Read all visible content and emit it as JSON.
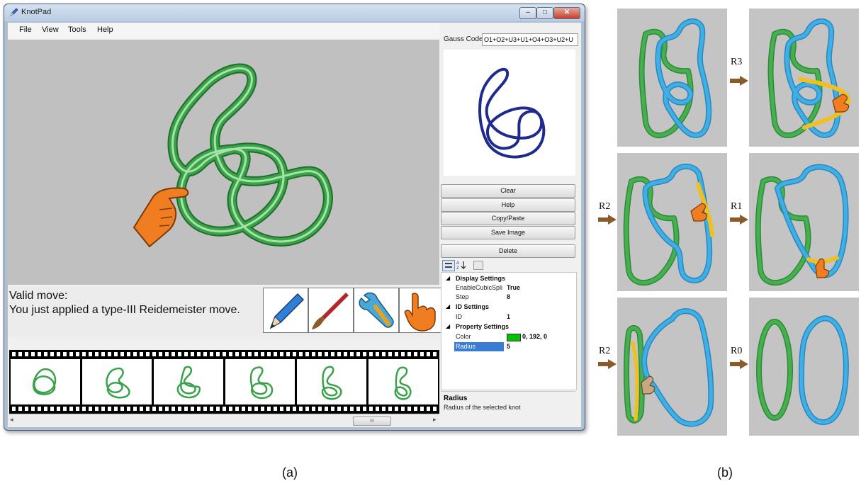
{
  "window": {
    "title": "KnotPad",
    "controls": [
      "–",
      "□",
      "✕"
    ]
  },
  "menu": [
    "File",
    "View",
    "Tools",
    "Help"
  ],
  "status": {
    "line1": "Valid move:",
    "line2": "You just applied a type-III Reidemeister move."
  },
  "tools": [
    {
      "name": "pencil-icon"
    },
    {
      "name": "brush-icon"
    },
    {
      "name": "wrench-icon"
    },
    {
      "name": "hand-icon"
    }
  ],
  "film": {
    "frames": 6
  },
  "scrollbar": {
    "left": "◂",
    "right": "▸",
    "thumb": "III"
  },
  "right_panel": {
    "gauss_label": "Gauss Code",
    "gauss_value": "O1+O2+U3+U1+O4+O3+U2+U",
    "buttons": [
      "Clear",
      "Help",
      "Copy/Paste",
      "Save Image",
      "Delete"
    ],
    "grid": {
      "display_settings": "Display Settings",
      "enable_name": "EnableCubicSpli",
      "enable_val": "True",
      "step_name": "Step",
      "step_val": "8",
      "id_settings": "ID Settings",
      "id_name": "ID",
      "id_val": "1",
      "property_settings": "Property Settings",
      "color_name": "Color",
      "color_val": "0, 192, 0",
      "color_swatch": "#00c000",
      "radius_name": "Radius",
      "radius_val": "5"
    },
    "description": {
      "title": "Radius",
      "text": "Radius of the selected knot"
    }
  },
  "figure_b": {
    "moves": [
      "R3",
      "R2",
      "R1",
      "R2",
      "R0"
    ]
  },
  "captions": {
    "a": "(a)",
    "b": "(b)"
  },
  "colors": {
    "knot_green": "#3aa34a",
    "knot_blue": "#3aa6dc",
    "highlight_yellow": "#f0c020",
    "hand_orange": "#f07e20",
    "arrow_brown": "#8b5a2b",
    "preview_knot": "#1e2a8c"
  }
}
